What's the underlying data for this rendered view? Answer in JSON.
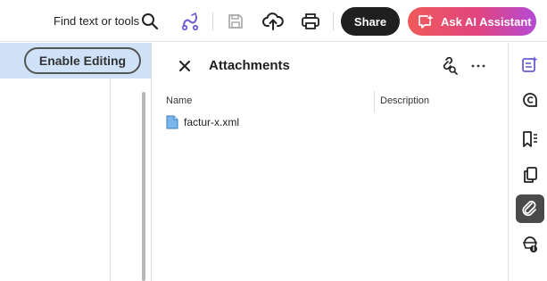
{
  "toolbar": {
    "find_label": "Find text or tools",
    "icons": [
      "search-icon",
      "fill-sign-icon",
      "save-icon",
      "upload-cloud-icon",
      "print-icon"
    ],
    "share_label": "Share",
    "ai_label": "Ask AI Assistant",
    "ai_gradient": [
      "#f05a5a",
      "#e0457f",
      "#b54ad6"
    ]
  },
  "document": {
    "enable_editing_label": "Enable Editing"
  },
  "attachments": {
    "title": "Attachments",
    "columns": {
      "name": "Name",
      "description": "Description"
    },
    "files": [
      {
        "name": "factur-x.xml",
        "description": ""
      }
    ]
  },
  "rail": {
    "items": [
      "edit-text-icon",
      "comment-icon",
      "bookmark-icon",
      "pages-icon",
      "attachment-icon",
      "accessibility-icon"
    ],
    "active": "attachment-icon",
    "accent": "#6b5cd6"
  }
}
